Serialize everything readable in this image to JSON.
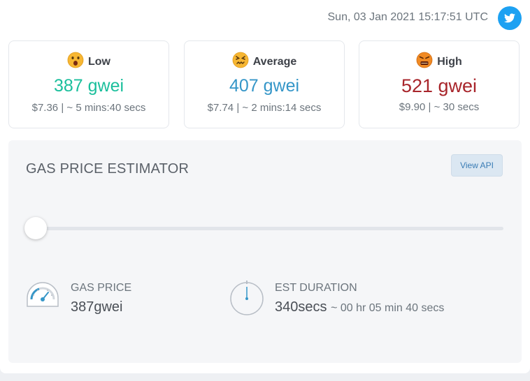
{
  "header": {
    "datetime": "Sun, 03 Jan 2021 15:17:51 UTC",
    "twitter_icon": "twitter-icon"
  },
  "tiers": [
    {
      "label": "Low",
      "price": "387 gwei",
      "meta_cost": "$7.36",
      "meta_time": "~ 5 mins:40 secs",
      "color": "#1bbf9c",
      "icon": "astonished-face-icon"
    },
    {
      "label": "Average",
      "price": "407 gwei",
      "meta_cost": "$7.74",
      "meta_time": "~ 2 mins:14 secs",
      "color": "#3596c8",
      "icon": "confounded-face-icon"
    },
    {
      "label": "High",
      "price": "521 gwei",
      "meta_cost": "$9.90",
      "meta_time": "~ 30 secs",
      "color": "#a8252b",
      "icon": "cursing-face-icon"
    }
  ],
  "estimator": {
    "title": "GAS PRICE ESTIMATOR",
    "view_api_label": "View API",
    "slider_value": 0,
    "gas_price_label": "GAS PRICE",
    "gas_price_value": "387gwei",
    "duration_label": "EST DURATION",
    "duration_value": "340secs",
    "duration_detail": "~ 00 hr 05 min 40 secs",
    "gas_icon": "speedometer-icon",
    "duration_icon": "stopwatch-icon"
  }
}
